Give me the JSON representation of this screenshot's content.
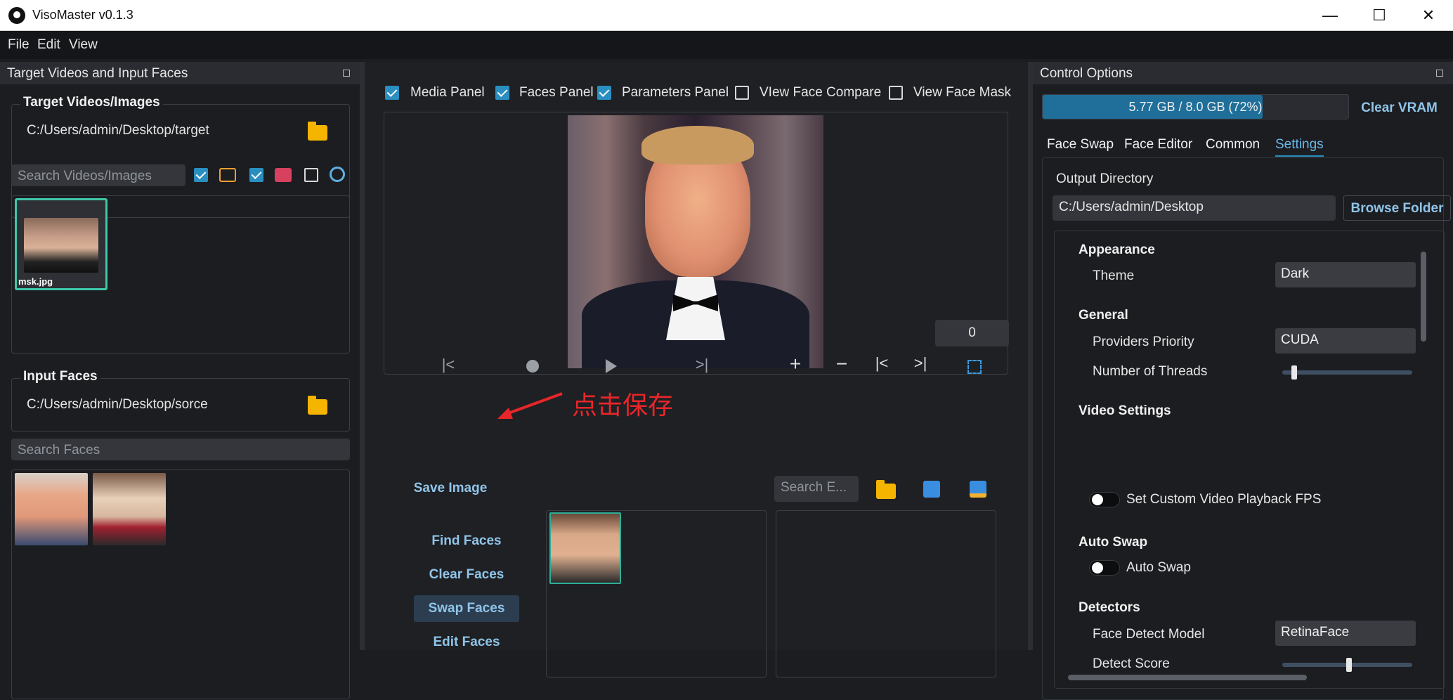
{
  "window": {
    "title": "VisoMaster v0.1.3",
    "minimize": "—",
    "maximize": "☐",
    "close": "✕"
  },
  "menu": [
    "File",
    "Edit",
    "View"
  ],
  "left_panel": {
    "title": "Target Videos and Input Faces",
    "target_group": {
      "title": "Target Videos/Images",
      "path": "C:/Users/admin/Desktop/target"
    },
    "search_videos_placeholder": "Search Videos/Images",
    "filters": [
      {
        "checked": true,
        "icon": "image-filter-icon"
      },
      {
        "checked": true,
        "icon": "video-filter-icon"
      },
      {
        "checked": false,
        "icon": "webcam-filter-icon"
      }
    ],
    "target_file": "msk.jpg",
    "input_group": {
      "title": "Input Faces",
      "path": "C:/Users/admin/Desktop/sorce"
    },
    "search_faces_placeholder": "Search Faces"
  },
  "center": {
    "panel_toggles": [
      {
        "label": "Media Panel",
        "checked": true
      },
      {
        "label": "Faces Panel",
        "checked": true
      },
      {
        "label": "Parameters Panel",
        "checked": true
      },
      {
        "label": "VIew Face Compare",
        "checked": false
      },
      {
        "label": "View Face Mask",
        "checked": false
      }
    ],
    "frame_number": "0",
    "annotation": "点击保存",
    "save_image": "Save Image",
    "search_embeddings_placeholder": "Search E...",
    "buttons": [
      "Find Faces",
      "Clear Faces",
      "Swap Faces",
      "Edit Faces"
    ]
  },
  "control": {
    "title": "Control Options",
    "vram_text": "5.77 GB / 8.0 GB (72%)",
    "vram_percent": 72,
    "clear_vram": "Clear VRAM",
    "tabs": [
      "Face Swap",
      "Face Editor",
      "Common",
      "Settings"
    ],
    "active_tab": "Settings",
    "output_label": "Output Directory",
    "output_path": "C:/Users/admin/Desktop",
    "browse": "Browse Folder",
    "sections": {
      "appearance": "Appearance",
      "theme_label": "Theme",
      "theme_value": "Dark",
      "general": "General",
      "providers_label": "Providers Priority",
      "providers_value": "CUDA",
      "threads_label": "Number of Threads",
      "video": "Video Settings",
      "fps_label": "Set Custom Video Playback FPS",
      "autoswap": "Auto Swap",
      "autoswap_label": "Auto Swap",
      "detectors": "Detectors",
      "detect_model_label": "Face Detect Model",
      "detect_model_value": "RetinaFace",
      "detect_score_label": "Detect Score"
    }
  },
  "colors": {
    "accent": "#2a8fc0",
    "button_text": "#8fc4e8",
    "annotation": "#e8262a"
  }
}
